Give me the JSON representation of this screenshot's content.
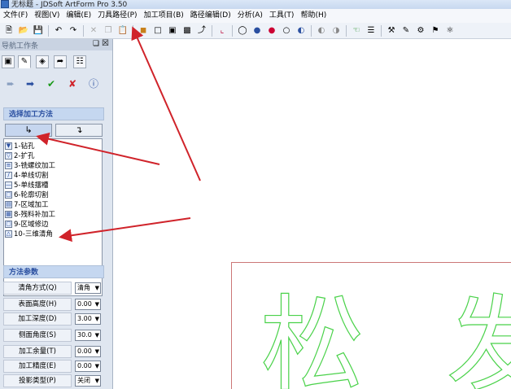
{
  "window": {
    "title": "无标题 - JDSoft ArtForm Pro 3.50"
  },
  "menu": [
    "文件(F)",
    "视图(V)",
    "编辑(E)",
    "刀具路径(P)",
    "加工项目(B)",
    "路径编辑(D)",
    "分析(A)",
    "工具(T)",
    "帮助(H)"
  ],
  "toolbar": {
    "icons": [
      "new-file-icon",
      "open-folder-icon",
      "save-icon",
      "undo-icon",
      "redo-icon",
      "cut-icon",
      "copy-icon",
      "paste-icon",
      "shaded-cube-icon",
      "view-cube-1-icon",
      "view-cube-2-icon",
      "view-cube-3-icon",
      "axis-icon",
      "coordinate-icon",
      "circle-view-1-icon",
      "circle-view-2-icon",
      "circle-view-3-icon",
      "circle-view-4-icon",
      "circle-view-5-icon",
      "render-1-icon",
      "render-2-icon",
      "select-icon",
      "layer-icon",
      "tool-1-icon",
      "tool-2-icon",
      "tool-3-icon",
      "tool-4-icon",
      "tool-5-icon"
    ]
  },
  "panel": {
    "title": "导航工作条",
    "section_method": "选择加工方法",
    "section_params": "方法参数",
    "methods": [
      "1-钻孔",
      "2-扩孔",
      "3-铣螺纹加工",
      "4-单线切割",
      "5-单线摆槽",
      "6-轮廓切割",
      "7-区域加工",
      "8-残料补加工",
      "9-区域修边",
      "10-三维清角"
    ],
    "params": [
      {
        "label": "清角方式(Q)",
        "value": "清角"
      },
      {
        "label": "表面高度(H)",
        "value": "0.00"
      },
      {
        "label": "加工深度(D)",
        "value": "3.00"
      },
      {
        "label": "侧面角度(S)",
        "value": "30.0"
      },
      {
        "label": "加工余量(T)",
        "value": "0.00"
      },
      {
        "label": "加工精度(E)",
        "value": "0.00"
      },
      {
        "label": "投影类型(P)",
        "value": "关闭"
      }
    ]
  },
  "canvas": {
    "text_outline": "松 发"
  },
  "colors": {
    "arrow": "#d0232a",
    "outline": "#4bd24b",
    "accent": "#2a4fa0"
  }
}
